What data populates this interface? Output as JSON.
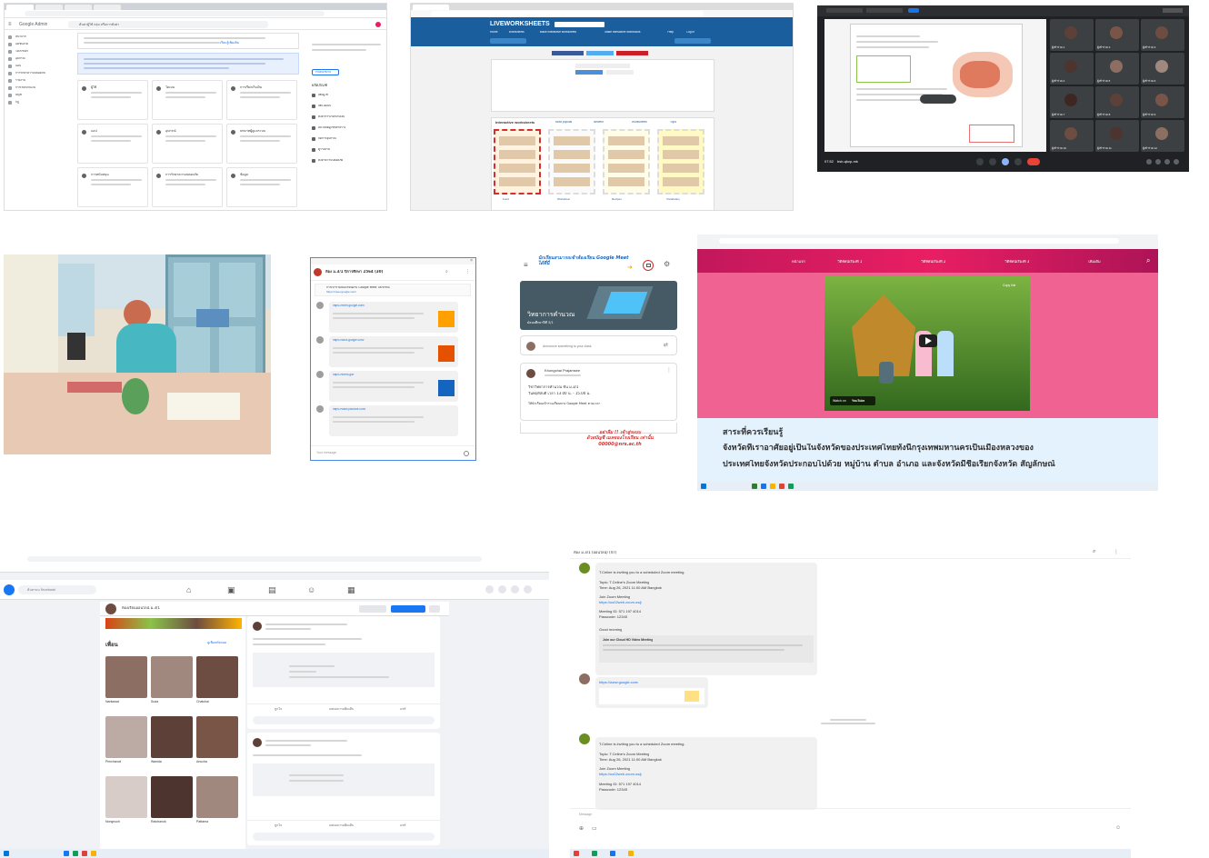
{
  "p1_admin": {
    "brand": "Google Admin",
    "search_placeholder": "ค้นหาผู้ใช้ กลุ่ม หรือการตั้งค่า",
    "nav": [
      "หน้าแรก",
      "แดชบอร์ด",
      "ไดเรกทอรี",
      "อุปกรณ์",
      "แอป",
      "การรักษาความปลอดภัย",
      "รายงาน",
      "การเรียกเก็บเงิน",
      "บัญชี",
      "กฎ"
    ],
    "alert_link": "เรียนรู้เพิ่มเติม",
    "card_titles": [
      "ผู้ใช้",
      "โดเมน",
      "การเรียกเก็บเงิน",
      "แอป",
      "อุปกรณ์",
      "บทบาทผู้ดูแลระบบ",
      "การสนับสนุน",
      "การรักษาความปลอดภัย",
      "ข้อมูล"
    ],
    "side_header": "ผลิตภัณฑ์",
    "side_btn": "เริ่มต้นใช้งาน",
    "side_items": [
      "เพิ่มผู้ใช้",
      "เพิ่มโดเมน",
      "ตั้งค่าการเรียกเก็บเงิน",
      "อัปโหลดผู้ใช้หลายราย",
      "จัดการอุปกรณ์",
      "ดูรายงาน",
      "ตั้งค่าความปลอดภัย"
    ]
  },
  "p2_liveworksheets": {
    "logo": "LIVEWORKSHEETS",
    "nav": [
      "Home",
      "Worksheets",
      "Make interactive worksheets",
      "Make interactive workbooks",
      "Help",
      "Log in"
    ],
    "section_title": "Interactive worksheets",
    "tabs": [
      "Most popular",
      "Newest",
      "Worksheets",
      "Topic"
    ],
    "thumb_labels": [
      "Food",
      "Worksheet",
      "Recipes",
      "Vocabulary"
    ]
  },
  "p3_meet_grid": {
    "participants": [
      "ผู้เข้าร่วม 1",
      "ผู้เข้าร่วม 2",
      "ผู้เข้าร่วม 3",
      "ผู้เข้าร่วม 4",
      "ผู้เข้าร่วม 5",
      "ผู้เข้าร่วม 6",
      "ผู้เข้าร่วม 7",
      "ผู้เข้าร่วม 8",
      "ผู้เข้าร่วม 9",
      "ผู้เข้าร่วม 10",
      "ผู้เข้าร่วม 11",
      "ผู้เข้าร่วม 12"
    ],
    "meeting_time": "07:52",
    "meeting_code": "bsb-qkcp-mk"
  },
  "p5_classroom_chat": {
    "title": "ห้อง ม.3/1 ปีการศึกษา 2564 (30)",
    "pinned": "การเข้าร่วมห้องเรียนผ่าน Google Meet ให้เข้าที่นี่",
    "links": [
      "https://meet.google.com/",
      "https://docs.google.com/",
      "https://forms.gle/",
      "https://www.youtube.com/"
    ],
    "footer_hint": "Your message"
  },
  "p6_classroom": {
    "banner_note": "นักเรียนสามารถเข้าห้องเรียน Google Meet ได้ที่นี่",
    "class_title": "วิทยาการคำนวณ",
    "class_sub": "มัธยมศึกษาปีที่ 3/1",
    "announce_placeholder": "Announce something to your class",
    "poster": "Khongchai Prajamsee",
    "post_line1": "วิชาวิทยาการคำนวณ ชั้น ม.3/1",
    "post_line2": "วันพฤหัสบดี เวลา 13.00 น. - 15.00 น.",
    "post_line3": "ให้นักเรียนเข้าร่วมเรียนทาง Google Meet ตามเวลา",
    "footer_red1": "อย่าลืม !! เข้าสู่ระบบ",
    "footer_red2": "ด้วยบัญชี เมลของโรงเรียน เท่านั้น",
    "footer_red3": "00000@nrs.ac.th"
  },
  "p7_video_lesson": {
    "menu": [
      "หน้าแรก",
      "วีดิทัศน์เรื่องที่ 1",
      "วีดิทัศน์เรื่องที่ 2",
      "วีดิทัศน์เรื่องที่ 3",
      "เพิ่มเติม"
    ],
    "watch_on": "Watch on",
    "yt": "YouTube",
    "copy_link": "Copy link",
    "heading": "สาระที่ควรเรียนรู้",
    "para1": "จังหวัดที่เราอาศัยอยู่เป็นในจังหวัดของประเทศไทยทั้งนี้กรุงเทพมหานครเป็นเมืองหลวงของ",
    "para2": "ประเทศไทยจังหวัดประกอบไปด้วย หมู่บ้าน ตำบล อำเภอ และจังหวัดมีชื่อเรียกจังหวัด สัญลักษณ์"
  },
  "p8_facebook": {
    "search_placeholder": "ค้นหาบน Facebook",
    "group_name": "ห้องเรียนออนไลน์ ม.3/1",
    "friends_title": "เพื่อน",
    "see_all": "ดูเพื่อนทั้งหมด",
    "friends": [
      "Nantawat",
      "Suda",
      "Chatchai",
      "Pimchanok",
      "Wanida",
      "Anucha",
      "Nongnuch",
      "Ratchanok",
      "Pattama"
    ],
    "like": "ถูกใจ",
    "comment": "แสดงความคิดเห็น",
    "share": "แชร์"
  },
  "p9_zoom_chat": {
    "title": "ห้อง ม.3/1 (ออนไลน์) (47)",
    "invite": "T.Celine is inviting you to a scheduled Zoom meeting.",
    "topic": "Topic: T.Celine's Zoom Meeting",
    "time": "Time: Aug 26, 2021 11:00 AM Bangkok",
    "join": "Join Zoom Meeting",
    "url": "https://us02web.zoom.us/j/",
    "meeting_id": "Meeting ID: 571 197 4014",
    "passcode": "Passcode: 12345",
    "good_morning": "Good morning",
    "join_hd": "Join our Cloud HD Video Meeting",
    "msg_placeholder": "Message"
  },
  "colors": {
    "google_blue": "#1a73e8",
    "lw_blue": "#1b5e9e",
    "meet_dark": "#202124",
    "pink_site": "#f06292",
    "fb_blue": "#1877f2",
    "red_note": "#d32f2f"
  }
}
